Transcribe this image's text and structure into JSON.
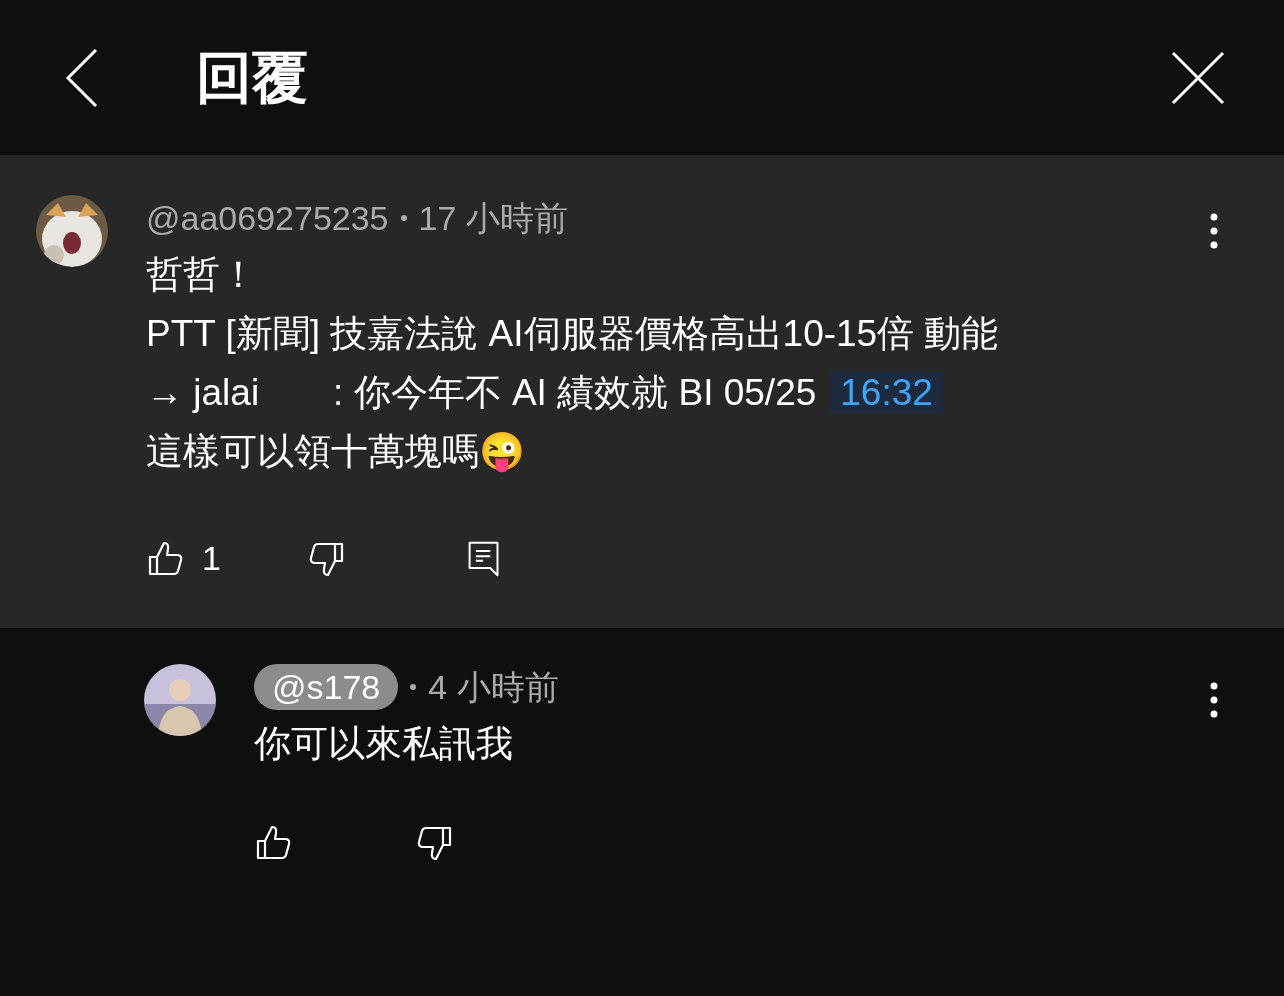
{
  "header": {
    "title": "回覆"
  },
  "comments": [
    {
      "highlighted": true,
      "author": "@aa069275235",
      "author_chip": false,
      "time": "17 小時前",
      "lines": [
        {
          "text": "哲哲！"
        },
        {
          "text": "PTT [新聞] 技嘉法說 AI伺服器價格高出10-15倍 動能"
        },
        {
          "text": "→ jalai　　: 你今年不 AI 績效就 BI 05/25",
          "timestamp": "16:32"
        },
        {
          "text": "這樣可以領十萬塊嗎😜"
        }
      ],
      "likes": "1",
      "actions": [
        {
          "kind": "like"
        },
        {
          "kind": "dislike"
        },
        {
          "kind": "reply"
        }
      ],
      "reply": false
    },
    {
      "highlighted": false,
      "author": "@s178",
      "author_chip": true,
      "time": "4 小時前",
      "lines": [
        {
          "text": "你可以來私訊我"
        }
      ],
      "actions": [
        {
          "kind": "like"
        },
        {
          "kind": "dislike"
        }
      ],
      "reply": true
    }
  ]
}
